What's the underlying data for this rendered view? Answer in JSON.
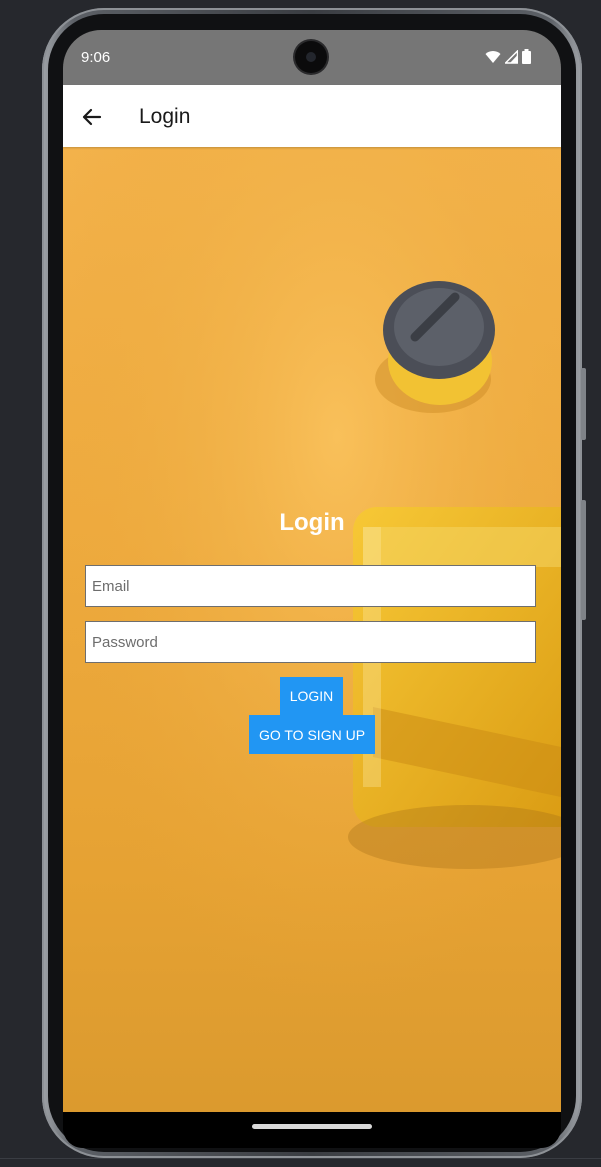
{
  "status_bar": {
    "time": "9:06",
    "icons": [
      "wifi-icon",
      "cellular-signal-icon",
      "battery-icon"
    ]
  },
  "app_bar": {
    "back_icon": "arrow-back-icon",
    "title": "Login"
  },
  "form": {
    "heading": "Login",
    "email": {
      "value": "",
      "placeholder": "Email"
    },
    "password": {
      "value": "",
      "placeholder": "Password"
    },
    "login_button": "LOGIN",
    "signup_button": "GO TO SIGN UP"
  },
  "colors": {
    "status_bar": "#767676",
    "app_bar": "#ffffff",
    "background_yellow": "#f1ae45",
    "button_blue": "#2196f3"
  }
}
